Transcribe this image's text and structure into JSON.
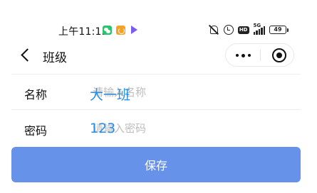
{
  "status_bar": {
    "time": "上午11:15",
    "network_label": "5G",
    "hd_label": "HD",
    "battery_level": "49",
    "icons": [
      "wechat-icon",
      "orange-app-icon",
      "play-store-icon",
      "mute-icon",
      "alarm-icon",
      "hd-icon",
      "signal-icon",
      "battery-icon"
    ]
  },
  "nav": {
    "title": "班级",
    "back_icon": "chevron-left-icon",
    "more_icon": "more-dots-icon",
    "close_icon": "target-circle-icon"
  },
  "form": {
    "name": {
      "label": "名称",
      "placeholder": "请输入名称",
      "value": "大一班"
    },
    "password": {
      "label": "密码",
      "placeholder": "请输入密码",
      "value": "123"
    }
  },
  "actions": {
    "save_label": "保存"
  },
  "colors": {
    "accent": "#6792ea",
    "typed_text": "#2a8fe6",
    "placeholder": "#bdbdbd",
    "divider": "#ededed"
  }
}
